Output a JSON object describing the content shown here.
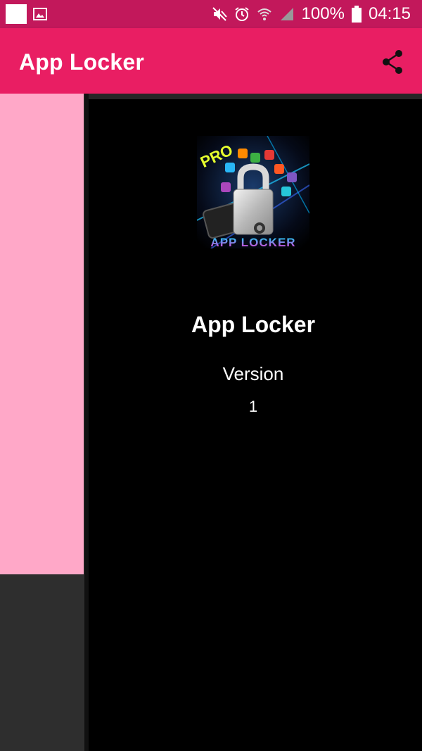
{
  "status_bar": {
    "battery_text": "100%",
    "time": "04:15",
    "icons": [
      "mute-icon",
      "alarm-icon",
      "wifi-icon",
      "signal-icon",
      "battery-icon",
      "image-icon"
    ]
  },
  "app_bar": {
    "title": "App Locker",
    "action_icon": "share-icon"
  },
  "drawer": {
    "icon_logo_text": [
      "PRO",
      "APP LOCKER"
    ],
    "app_name": "App Locker",
    "version_label": "Version",
    "version_value": "1"
  },
  "colors": {
    "status_bar": "#c2185b",
    "app_bar": "#e91e63",
    "pink_panel": "#ffa8c8",
    "drawer_bg": "#000000"
  }
}
